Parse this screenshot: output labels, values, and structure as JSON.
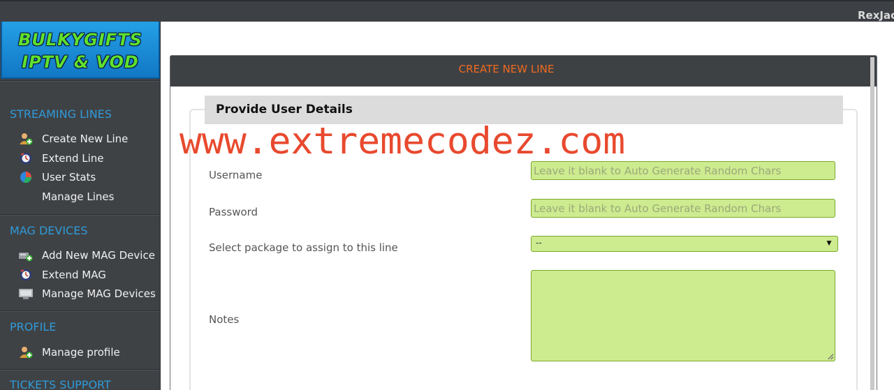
{
  "topbar": {
    "user": "RexJac"
  },
  "logo": {
    "line1": "BULKYGIFTS",
    "line2": "IPTV & VOD"
  },
  "sidebar": {
    "sections": [
      {
        "title": "STREAMING LINES",
        "items": [
          "Create New Line",
          "Extend Line",
          "User Stats",
          "Manage Lines"
        ]
      },
      {
        "title": "MAG DEVICES",
        "items": [
          "Add New MAG Device",
          "Extend MAG",
          "Manage MAG Devices"
        ]
      },
      {
        "title": "PROFILE",
        "items": [
          "Manage profile"
        ]
      },
      {
        "title": "TICKETS SUPPORT",
        "items": []
      }
    ]
  },
  "panel": {
    "title": "CREATE NEW LINE",
    "legend": "Provide User Details",
    "watermark": "www.extremecodez.com",
    "fields": {
      "username_label": "Username",
      "username_placeholder": "Leave it blank to Auto Generate Random Chars",
      "password_label": "Password",
      "password_placeholder": "Leave it blank to Auto Generate Random Chars",
      "package_label": "Select package to assign to this line",
      "package_value": "--",
      "notes_label": "Notes"
    }
  },
  "colors": {
    "sidebar_bg": "#3f4245",
    "section_title": "#2f9ad8",
    "panel_title": "#f16a1e",
    "input_bg": "#cdeb8f",
    "watermark": "#e8492e"
  }
}
